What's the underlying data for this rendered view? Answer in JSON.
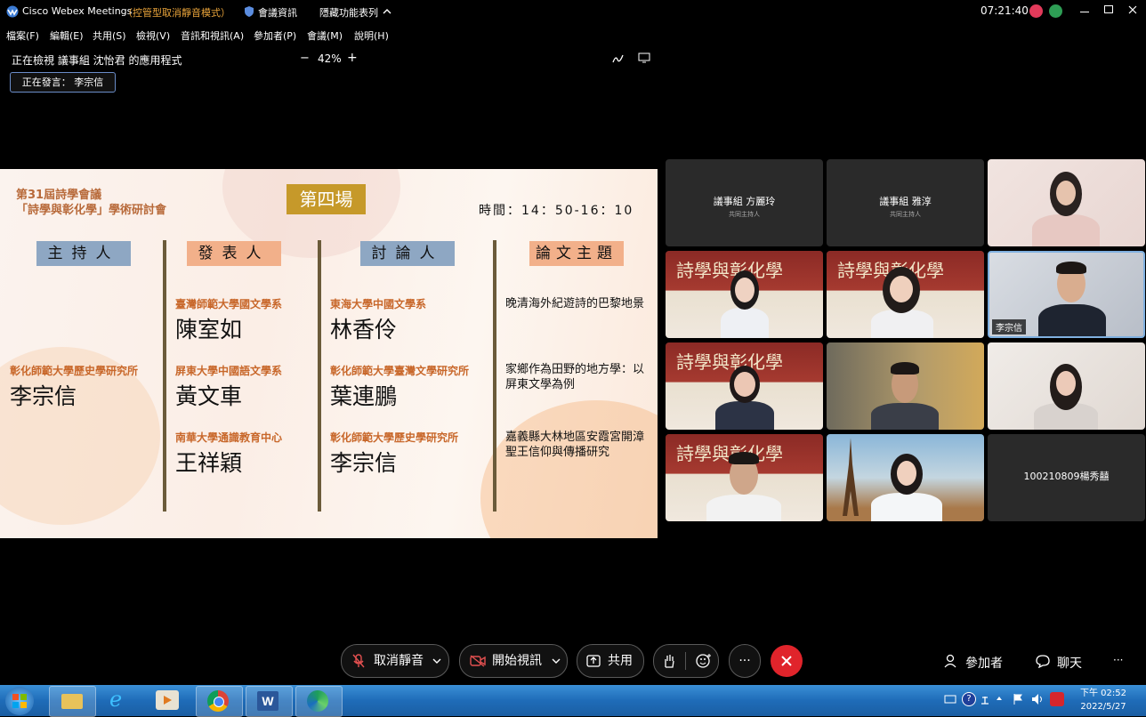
{
  "titlebar": {
    "app_name": "Cisco Webex Meetings",
    "mode": "（控管型取消靜音模式）",
    "meeting_info": "會議資訊",
    "hide_menu": "隱藏功能表列",
    "clock": "07:21:40"
  },
  "menu": [
    "檔案(F)",
    "編輯(E)",
    "共用(S)",
    "檢視(V)",
    "音訊和視訊(A)",
    "參加者(P)",
    "會議(M)",
    "說明(H)"
  ],
  "viewbar": {
    "viewing": "正在檢視 議事組 沈怡君 的應用程式",
    "zoom_minus": "−",
    "zoom": "42%",
    "zoom_plus": "+"
  },
  "speaking": "正在發言： 李宗信",
  "slide": {
    "conference_line1": "第31屆詩學會議",
    "conference_line2": "「詩學與彰化學」學術研討會",
    "session": "第四場",
    "time": "時間：14：50-16：10",
    "headers": [
      "主持人",
      "發表人",
      "討論人",
      "論文主題"
    ],
    "host": {
      "affiliation": "彰化師範大學歷史學研究所",
      "name": "李宗信"
    },
    "presenters": [
      {
        "affiliation": "臺灣師範大學國文學系",
        "name": "陳室如"
      },
      {
        "affiliation": "屏東大學中國語文學系",
        "name": "黃文車"
      },
      {
        "affiliation": "南華大學通識教育中心",
        "name": "王祥穎"
      }
    ],
    "discussants": [
      {
        "affiliation": "東海大學中國文學系",
        "name": "林香伶"
      },
      {
        "affiliation": "彰化師範大學臺灣文學研究所",
        "name": "葉連鵬"
      },
      {
        "affiliation": "彰化師範大學歷史學研究所",
        "name": "李宗信"
      }
    ],
    "topics": [
      "晚清海外紀遊詩的巴黎地景",
      "家鄉作為田野的地方學：以屏東文學為例",
      "嘉義縣大林地區安霞宮開漳聖王信仰與傳播研究"
    ]
  },
  "tiles": {
    "t1_name": "議事組 方麗玲",
    "t1_role": "共同主持人",
    "t2_name": "議事組 雅淳",
    "t2_role": "共同主持人",
    "t6_chip": "李宗信",
    "t12_name": "100210809楊秀囍",
    "banner_text": "詩學與彰化學"
  },
  "controls": {
    "unmute": "取消靜音",
    "start_video": "開始視訊",
    "share": "共用",
    "more": "···",
    "participants": "參加者",
    "chat": "聊天",
    "overflow": "···"
  },
  "taskbar": {
    "time_ampm": "下午 02:52",
    "date": "2022/5/27"
  },
  "colors": {
    "end_button": "#e0242b",
    "session_badge": "#c6992a",
    "affiliation": "#c8672a",
    "taskbar": "#1f6cb8"
  }
}
